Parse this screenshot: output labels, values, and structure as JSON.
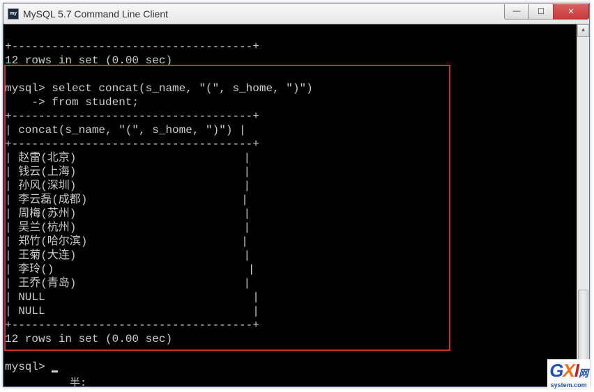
{
  "window": {
    "title": "MySQL 5.7 Command Line Client",
    "icon_label": "my"
  },
  "controls": {
    "min_symbol": "—",
    "max_symbol": "☐",
    "close_symbol": "✕"
  },
  "terminal": {
    "top_sep": "+------------------------------------+",
    "prev_result": "12 rows in set (0.00 sec)",
    "prompt1": "mysql> ",
    "query1": "select concat(s_name, \"(\", s_home, \")\")",
    "prompt2": "    -> ",
    "query2": "from student;",
    "header_sep": "+------------------------------------+",
    "header_row": "| concat(s_name, \"(\", s_home, \")\") |",
    "header_sep2": "+------------------------------------+",
    "rows": [
      "| 赵雷(北京)                         |",
      "| 钱云(上海)                         |",
      "| 孙风(深圳)                         |",
      "| 李云磊(成都)                       |",
      "| 周梅(苏州)                         |",
      "| 吴兰(杭州)                         |",
      "| 郑竹(哈尔滨)                       |",
      "| 王菊(大连)                         |",
      "| 李玲()                             |",
      "| 王乔(青岛)                         |",
      "| NULL                               |",
      "| NULL                               |"
    ],
    "footer_sep": "+------------------------------------+",
    "result_msg": "12 rows in set (0.00 sec)",
    "prompt3": "mysql> "
  },
  "ime": {
    "status": "半:"
  },
  "watermark": {
    "g": "G",
    "x": "X",
    "i": "I",
    "net": "网",
    "sys": "system.com"
  }
}
